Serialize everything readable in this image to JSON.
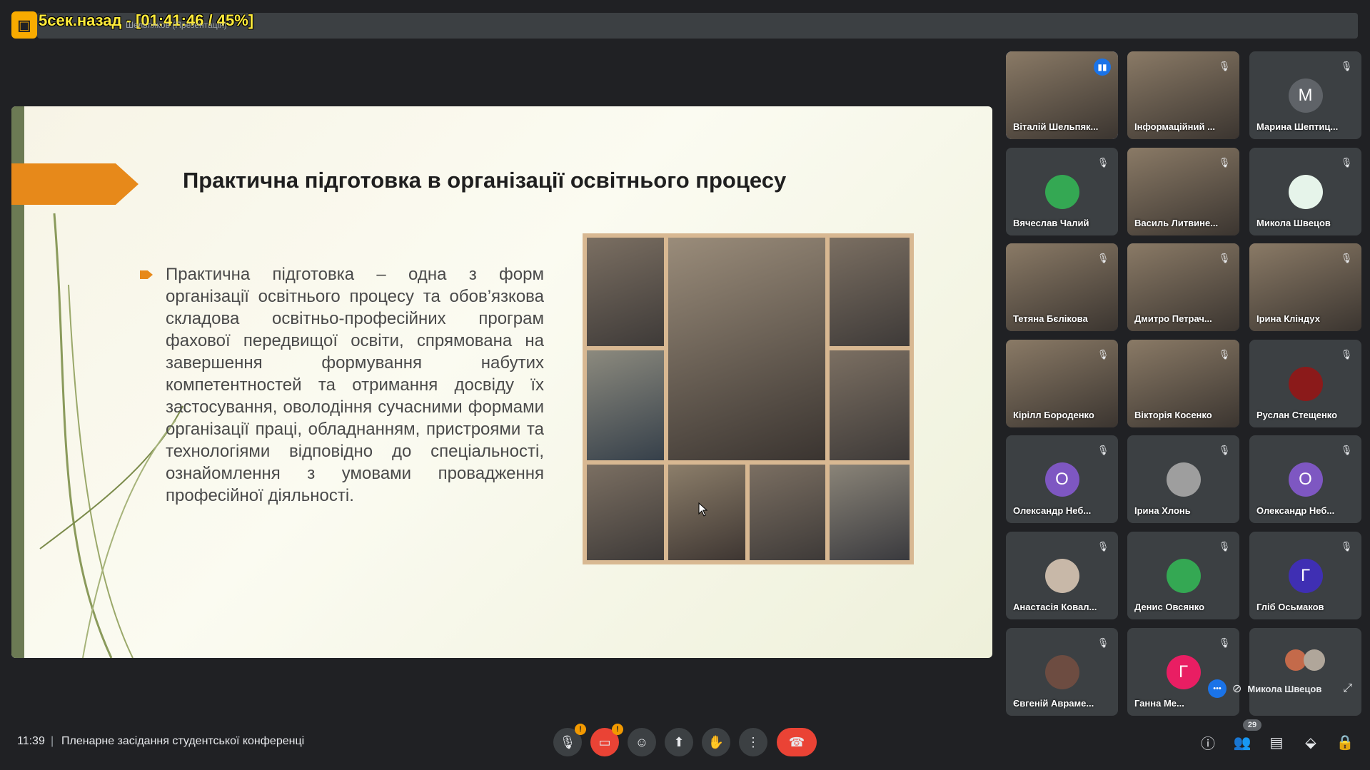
{
  "overlay": {
    "recording_text": "5сек.назад - [01:41:46 / 45%]",
    "presenter_hint": "Шельпяков (Презентація)"
  },
  "slide": {
    "title": "Практична підготовка в організації освітнього процесу",
    "body": "Практична підготовка – одна з форм організації освітнього процесу та обов’язкова складова освітньо-професійних програм фахової передвищої освіти, спрямована на завершення формування набутих компетентностей та отримання досвіду їх застосування, оволодіння сучасними формами організації праці, обладнанням, пристроями та технологіями відповідно до спеціальності, ознайомлення з умовами провадження професійної діяльності."
  },
  "participants": [
    {
      "name": "Віталій Шельпяк...",
      "type": "video",
      "speaking": true
    },
    {
      "name": "Інформаційний ...",
      "type": "video"
    },
    {
      "name": "Марина Шептиц...",
      "type": "letter",
      "letter": "М",
      "color": "#5f6368"
    },
    {
      "name": "Вячеслав Чалий",
      "type": "photo",
      "color": "#34a853"
    },
    {
      "name": "Василь Литвине...",
      "type": "video"
    },
    {
      "name": "Микола Швецов",
      "type": "photo",
      "color": "#e6f4ea"
    },
    {
      "name": "Тетяна Бєлікова",
      "type": "video"
    },
    {
      "name": "Дмитро Петрач...",
      "type": "video"
    },
    {
      "name": "Ірина Кліндух",
      "type": "video"
    },
    {
      "name": "Кірілл Бороденко",
      "type": "video"
    },
    {
      "name": "Вікторія Косенко",
      "type": "video"
    },
    {
      "name": "Руслан Стещенко",
      "type": "photo",
      "color": "#8b1a1a"
    },
    {
      "name": "Олександр Неб...",
      "type": "letter",
      "letter": "О",
      "color": "#7e57c2"
    },
    {
      "name": "Ірина Хлонь",
      "type": "photo",
      "color": "#9e9e9e"
    },
    {
      "name": "Олександр Неб...",
      "type": "letter",
      "letter": "О",
      "color": "#7e57c2"
    },
    {
      "name": "Анастасія Ковал...",
      "type": "photo",
      "color": "#c8b8a8"
    },
    {
      "name": "Денис Овсянко",
      "type": "photo",
      "color": "#34a853"
    },
    {
      "name": "Гліб Осьмаков",
      "type": "letter",
      "letter": "Г",
      "color": "#3f2fb3"
    },
    {
      "name": "Євгеній Авраме...",
      "type": "photo",
      "color": "#6d4c41"
    },
    {
      "name": "Ганна Ме...",
      "type": "letter",
      "letter": "Г",
      "color": "#e91e63"
    }
  ],
  "self_tile": {
    "name": "Микола Швецов",
    "more_label": "•••"
  },
  "bottom": {
    "time": "11:39",
    "separator": "|",
    "meeting_title": "Пленарне засідання студентської конференці",
    "participants_count": "29"
  },
  "icons": {
    "mic": "mic-off-icon",
    "camera": "camera-off-icon",
    "emoji": "emoji-icon",
    "present": "present-icon",
    "hand": "raise-hand-icon",
    "more": "more-icon",
    "end": "end-call-icon",
    "info": "info-icon",
    "people": "people-icon",
    "chat": "chat-icon",
    "activities": "activities-icon",
    "lock": "host-controls-icon"
  },
  "colors": {
    "accent_orange": "#e7891a",
    "end_call_red": "#ea4335",
    "warning_orange": "#f29900",
    "speaking_blue": "#1a73e8"
  }
}
